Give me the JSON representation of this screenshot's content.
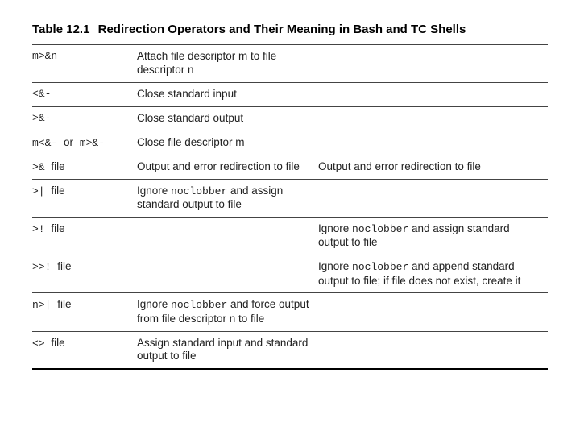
{
  "table": {
    "number": "Table 12.1",
    "title": "Redirection Operators and Their Meaning in Bash and TC Shells",
    "rows": [
      {
        "op_html": "m>&n",
        "col2_html": "Attach file descriptor m to file descriptor n",
        "col3_html": ""
      },
      {
        "op_html": "<&-",
        "col2_html": "Close standard input",
        "col3_html": ""
      },
      {
        "op_html": ">&-",
        "col2_html": "Close standard output",
        "col3_html": ""
      },
      {
        "op_html": "m<&- <span class=\"norm\">or</span> m>&-",
        "col2_html": "Close file descriptor m",
        "col3_html": ""
      },
      {
        "op_html": ">& <span class=\"norm\">file</span>",
        "col2_html": "Output and error redirection to file",
        "col3_html": "Output and error redirection to file"
      },
      {
        "op_html": ">| <span class=\"norm\">file</span>",
        "col2_html": "Ignore <span class=\"mono\">noclobber</span> and assign standard output to file",
        "col3_html": ""
      },
      {
        "op_html": ">! <span class=\"norm\">file</span>",
        "col2_html": "",
        "col3_html": "Ignore <span class=\"mono\">noclobber</span> and assign standard output to file"
      },
      {
        "op_html": ">>! <span class=\"norm\">file</span>",
        "col2_html": "",
        "col3_html": "Ignore <span class=\"mono\">noclobber</span> and append standard output to file; if file does not exist, create it"
      },
      {
        "op_html": "n>| <span class=\"norm\"> file</span>",
        "col2_html": "Ignore <span class=\"mono\">noclobber</span> and force output from file descriptor n to file",
        "col3_html": ""
      },
      {
        "op_html": "<> <span class=\"norm\"> file</span>",
        "col2_html": "Assign standard input and standard output to file",
        "col3_html": ""
      }
    ]
  }
}
